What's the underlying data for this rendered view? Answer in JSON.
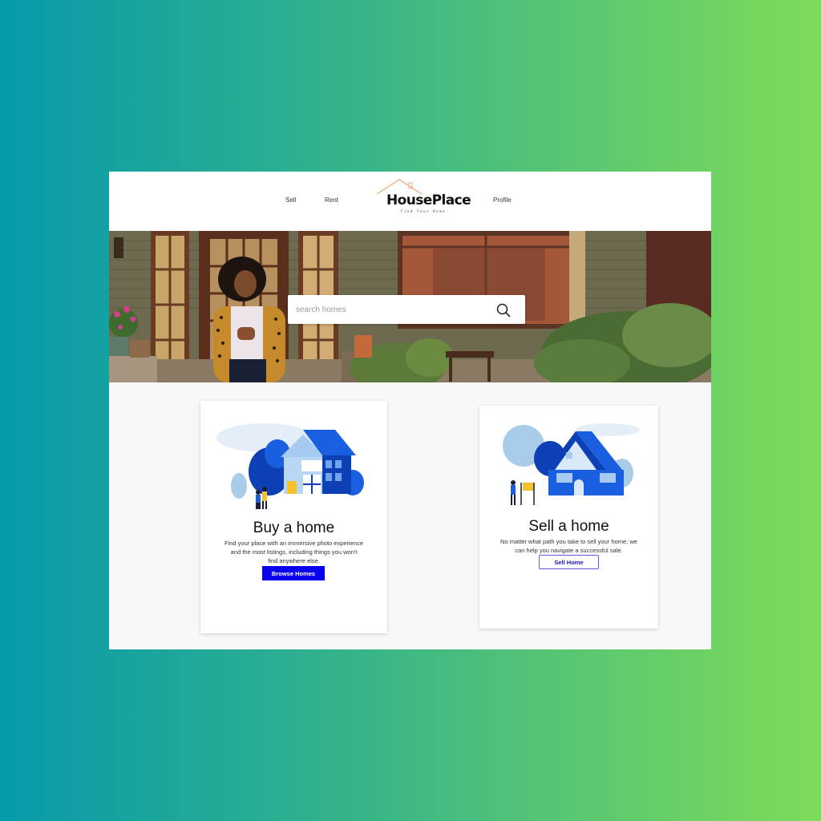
{
  "nav": {
    "sell_label": "Sell",
    "rent_label": "Rent",
    "profile_label": "Profile",
    "brand_name": "HousePlace",
    "brand_tagline": "Find Your Home",
    "logo_color": "#f2a67a"
  },
  "search": {
    "placeholder": "search homes",
    "icon": "search-icon"
  },
  "buy_card": {
    "title": "Buy a home",
    "description_line1": "Find your place with an immersive photo experience",
    "description_line2": "and the most listings, including things you won't",
    "description_line3": "find anywhere else.",
    "button_label": "Browse Homes"
  },
  "sell_card": {
    "title": "Sell a home",
    "description_line1": "No matter what path you take to sell your home, we",
    "description_line2": "can help you navigate a successful sale.",
    "button_label": "Sell Home"
  },
  "colors": {
    "primary_button": "#0a00f0",
    "illustration_blue": "#1a5fe0",
    "illustration_dark_blue": "#0d3fb5"
  }
}
